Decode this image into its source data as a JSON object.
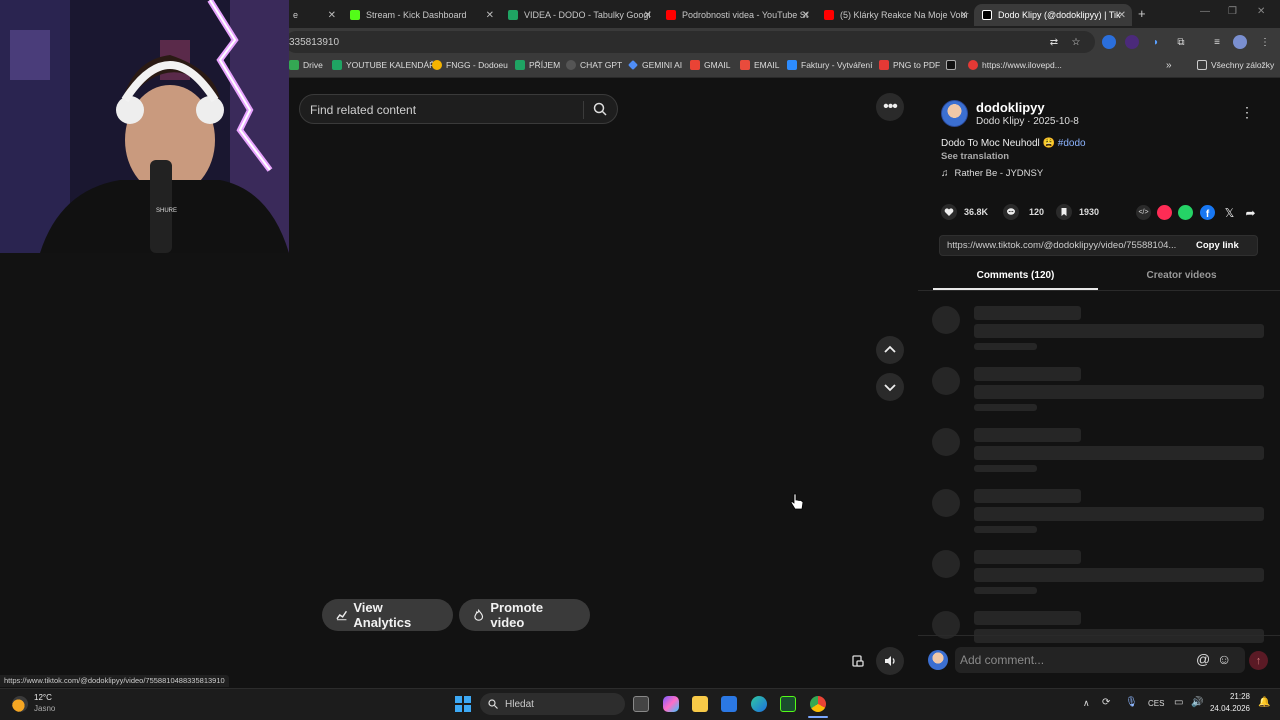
{
  "browser": {
    "tabs": [
      {
        "title": "e",
        "color": "#888888"
      },
      {
        "title": "Stream - Kick Dashboard",
        "color": "#53fc18"
      },
      {
        "title": "VIDEA - DODO - Tabulky Googl",
        "color": "#1fa463"
      },
      {
        "title": "Podrobnosti videa - YouTube St",
        "color": "#ff0000"
      },
      {
        "title": "(5) Klárky Reakce Na Moje Vour",
        "color": "#ff0000"
      },
      {
        "title": "Dodo Klipy (@dodoklipyy) | Tik",
        "color": "#ffffff"
      }
    ],
    "url": "335813910",
    "bookmarks": [
      {
        "label": "Drive",
        "color": "#34a853"
      },
      {
        "label": "YOUTUBE KALENDÁŘ",
        "color": "#1fa463"
      },
      {
        "label": "FNGG - Dodoeu",
        "color": "#f5b400"
      },
      {
        "label": "PŘÍJEM",
        "color": "#1fa463"
      },
      {
        "label": "CHAT GPT",
        "color": "#cccccc"
      },
      {
        "label": "GEMINI AI",
        "color": "#4f8ef7"
      },
      {
        "label": "GMAIL",
        "color": "#ea4335"
      },
      {
        "label": "EMAIL",
        "color": "#e94b3c"
      },
      {
        "label": "Faktury - Vytváření",
        "color": "#2d8cff"
      },
      {
        "label": "PNG to PDF",
        "color": "#e53935"
      },
      {
        "label": "",
        "color": "#222222"
      },
      {
        "label": "https://www.ilovepd...",
        "color": "#e53935"
      }
    ],
    "all_bookmarks": "Všechny záložky",
    "status_url": "https://www.tiktok.com/@dodoklipyy/video/7558810488335813910"
  },
  "video": {
    "search_placeholder": "Find related content",
    "view_analytics": "View Analytics",
    "promote_video": "Promote video"
  },
  "author": {
    "username": "dodoklipyy",
    "display_name": "Dodo Klipy",
    "date": "2025-10-8",
    "separator": " · ",
    "caption": "Dodo To Moc Neuhodl 😩",
    "hashtag": "#dodo",
    "see_translation": "See translation",
    "music": "Rather Be - JYDNSY"
  },
  "stats": {
    "likes": "36.8K",
    "comments": "120",
    "saves": "1930"
  },
  "share": {
    "link": "https://www.tiktok.com/@dodoklipyy/video/75588104...",
    "copy_link": "Copy link"
  },
  "tabs": {
    "comments": "Comments (120)",
    "creator_videos": "Creator videos"
  },
  "comment_input": {
    "placeholder": "Add comment..."
  },
  "taskbar": {
    "weather_temp": "12°C",
    "weather_desc": "Jasno",
    "search": "Hledat",
    "lang": "CES",
    "time": "21:28",
    "date": "24.04.2026"
  }
}
